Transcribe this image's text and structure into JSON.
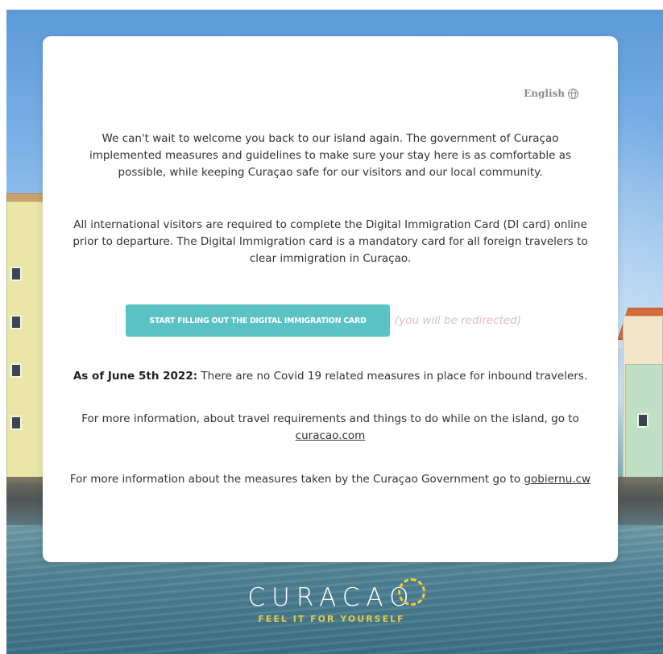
{
  "language": {
    "label": "English",
    "icon": "globe-icon"
  },
  "intro": "We can't wait to welcome you back to our island again. The government of Curaçao implemented measures and guidelines to make sure your stay here is as comfortable as possible, while keeping Curaçao safe for our visitors and our local community.",
  "requirement": "All international visitors are required to complete the Digital Immigration Card (DI card) online prior to departure. The Digital Immigration card is a mandatory card for all foreign travelers to clear immigration in Curaçao.",
  "cta": {
    "label": "START FILLING OUT THE DIGITAL IMMIGRATION CARD",
    "note": "(you will be redirected)"
  },
  "covid": {
    "bold": "As of June 5th 2022:",
    "text": " There are no Covid 19 related measures in place for inbound travelers."
  },
  "more_info": {
    "text": "For more information, about travel requirements and things to do while on the island, go to ",
    "link": "curacao.com"
  },
  "gov_info": {
    "text": "For more information about the measures taken by the Curaçao Government go to ",
    "link": "gobiernu.cw"
  },
  "logo": {
    "word": "CURACAO",
    "tagline": "FEEL IT FOR YOURSELF"
  },
  "colors": {
    "accent": "#5bc2c3",
    "redirect_note": "#e2b9c4",
    "logo_sun": "#f4c93a"
  }
}
